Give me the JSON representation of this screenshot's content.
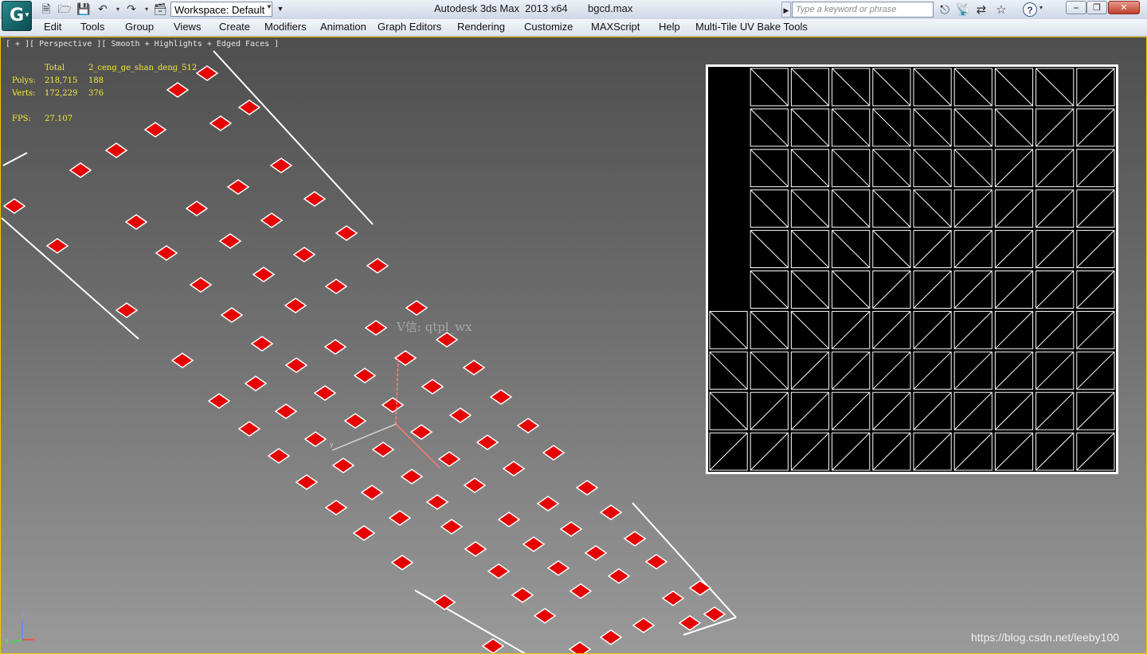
{
  "titlebar": {
    "app_logo": "G",
    "workspace": "Workspace: Default",
    "window_title": "Autodesk 3ds Max  2013 x64",
    "file_name": "bgcd.max",
    "search_placeholder": "Type a keyword or phrase",
    "help_label": "?",
    "quick_access_icons": [
      "new-file-icon",
      "open-file-icon",
      "save-icon",
      "undo-icon",
      "redo-icon",
      "project-folder-icon"
    ],
    "infocenter_icons": [
      "binoculars-icon",
      "satellite-icon",
      "exchange-icon",
      "favorites-star-icon"
    ]
  },
  "menu": {
    "items": [
      "Edit",
      "Tools",
      "Group",
      "Views",
      "Create",
      "Modifiers",
      "Animation",
      "Graph Editors",
      "Rendering",
      "Customize",
      "MAXScript",
      "Help",
      "Multi-Tile UV Bake Tools"
    ]
  },
  "viewport": {
    "label": "[ + ][ Perspective ][ Smooth + Highlights + Edged Faces ]",
    "stats": {
      "header_total": "Total",
      "header_object": "2_ceng_ge_shan_deng_512",
      "polys_label": "Polys:",
      "polys_total": "218,715",
      "polys_object": "188",
      "verts_label": "Verts:",
      "verts_total": "172,229",
      "verts_object": "376",
      "fps_label": "FPS:",
      "fps_value": "27.107"
    },
    "axis_labels": {
      "z": "z",
      "x": "x",
      "y": "y"
    },
    "gizmo_label": "y",
    "watermark": "V信: qtpl_wx",
    "csdn_watermark": "https://blog.csdn.net/leeby100",
    "colors": {
      "highlight_border": "#f2c400",
      "tile_red": "#e60000",
      "outline": "#ffffff",
      "stat_text": "#f2ea3a"
    }
  },
  "uv_panel": {
    "grid_cols": 10,
    "grid_rows": 10,
    "empty_column_rows": 6,
    "diagonal_direction": "mixed"
  }
}
